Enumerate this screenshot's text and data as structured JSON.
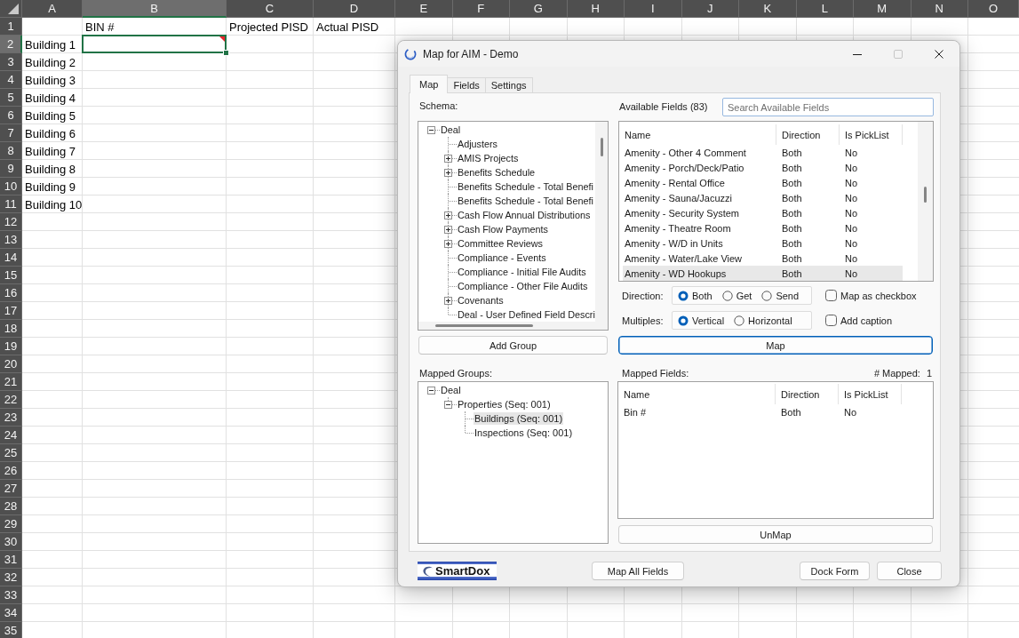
{
  "spreadsheet": {
    "columns": [
      {
        "label": "A",
        "selected": false
      },
      {
        "label": "B",
        "selected": true
      },
      {
        "label": "C",
        "selected": false
      },
      {
        "label": "D",
        "selected": false
      },
      {
        "label": "E",
        "selected": false
      },
      {
        "label": "F",
        "selected": false
      },
      {
        "label": "G",
        "selected": false
      },
      {
        "label": "H",
        "selected": false
      },
      {
        "label": "I",
        "selected": false
      },
      {
        "label": "J",
        "selected": false
      },
      {
        "label": "K",
        "selected": false
      },
      {
        "label": "L",
        "selected": false
      },
      {
        "label": "M",
        "selected": false
      },
      {
        "label": "N",
        "selected": false
      },
      {
        "label": "O",
        "selected": false
      }
    ],
    "rows": [
      {
        "number": "1",
        "selected": false,
        "column_b": "BIN #",
        "column_c": "Projected PISD",
        "column_d": "Actual PISD"
      },
      {
        "number": "2",
        "selected": true,
        "column_a": "Building 1"
      },
      {
        "number": "3",
        "selected": false,
        "column_a": "Building 2"
      },
      {
        "number": "4",
        "selected": false,
        "column_a": "Building 3"
      },
      {
        "number": "5",
        "selected": false,
        "column_a": "Building 4"
      },
      {
        "number": "6",
        "selected": false,
        "column_a": "Building 5"
      },
      {
        "number": "7",
        "selected": false,
        "column_a": "Building 6"
      },
      {
        "number": "8",
        "selected": false,
        "column_a": "Building 7"
      },
      {
        "number": "9",
        "selected": false,
        "column_a": "Building 8"
      },
      {
        "number": "10",
        "selected": false,
        "column_a": "Building 9"
      },
      {
        "number": "11",
        "selected": false,
        "column_a": "Building 10"
      },
      {
        "number": "12",
        "selected": false
      },
      {
        "number": "13",
        "selected": false
      },
      {
        "number": "14",
        "selected": false
      },
      {
        "number": "15",
        "selected": false
      },
      {
        "number": "16",
        "selected": false
      },
      {
        "number": "17",
        "selected": false
      },
      {
        "number": "18",
        "selected": false
      },
      {
        "number": "19",
        "selected": false
      },
      {
        "number": "20",
        "selected": false
      },
      {
        "number": "21",
        "selected": false
      },
      {
        "number": "22",
        "selected": false
      },
      {
        "number": "23",
        "selected": false
      },
      {
        "number": "24",
        "selected": false
      },
      {
        "number": "25",
        "selected": false
      },
      {
        "number": "26",
        "selected": false
      },
      {
        "number": "27",
        "selected": false
      },
      {
        "number": "28",
        "selected": false
      },
      {
        "number": "29",
        "selected": false
      },
      {
        "number": "30",
        "selected": false
      },
      {
        "number": "31",
        "selected": false
      },
      {
        "number": "32",
        "selected": false
      },
      {
        "number": "33",
        "selected": false
      },
      {
        "number": "34",
        "selected": false
      },
      {
        "number": "35",
        "selected": false
      }
    ],
    "note_marker": true
  },
  "dialog": {
    "title": "Map for AIM - Demo",
    "caption_buttons": [
      {
        "kind": "minimize",
        "disabled": false
      },
      {
        "kind": "maximize",
        "disabled": true
      },
      {
        "kind": "close",
        "disabled": false
      }
    ],
    "tabs": [
      {
        "label": "Map",
        "selected": true
      },
      {
        "label": "Fields",
        "selected": false
      },
      {
        "label": "Settings",
        "selected": false
      }
    ],
    "schema": {
      "label": "Schema:",
      "tree": [
        {
          "label": "Deal",
          "kind": "branch",
          "expanded": true,
          "selected": false,
          "children": [
            {
              "label": "Adjusters",
              "kind": "leaf",
              "selected": false
            },
            {
              "label": "AMIS Projects",
              "kind": "branch",
              "expanded": false,
              "selected": false
            },
            {
              "label": "Benefits Schedule",
              "kind": "branch",
              "expanded": false,
              "selected": false
            },
            {
              "label": "Benefits Schedule - Total Benefi",
              "kind": "leaf",
              "selected": false
            },
            {
              "label": "Benefits Schedule - Total Benefi",
              "kind": "leaf",
              "selected": false
            },
            {
              "label": "Cash Flow Annual Distributions",
              "kind": "branch",
              "expanded": false,
              "selected": false
            },
            {
              "label": "Cash Flow Payments",
              "kind": "branch",
              "expanded": false,
              "selected": false
            },
            {
              "label": "Committee Reviews",
              "kind": "branch",
              "expanded": false,
              "selected": false
            },
            {
              "label": "Compliance - Events",
              "kind": "leaf",
              "selected": false
            },
            {
              "label": "Compliance - Initial File Audits",
              "kind": "leaf",
              "selected": false
            },
            {
              "label": "Compliance - Other File Audits",
              "kind": "leaf",
              "selected": false
            },
            {
              "label": "Covenants",
              "kind": "branch",
              "expanded": false,
              "selected": false
            },
            {
              "label": "Deal - User Defined Field Descri",
              "kind": "leaf",
              "selected": false
            }
          ]
        }
      ]
    },
    "available_fields": {
      "label": "Available Fields (83)",
      "search": {
        "placeholder": "Search Available Fields"
      },
      "columns": [
        "Name",
        "Direction",
        "Is PickList"
      ],
      "rows": [
        {
          "name": "Amenity - Other 4 Comment",
          "direction": "Both",
          "is_picklist": "No",
          "selected": false
        },
        {
          "name": "Amenity - Porch/Deck/Patio",
          "direction": "Both",
          "is_picklist": "No",
          "selected": false
        },
        {
          "name": "Amenity - Rental Office",
          "direction": "Both",
          "is_picklist": "No",
          "selected": false
        },
        {
          "name": "Amenity - Sauna/Jacuzzi",
          "direction": "Both",
          "is_picklist": "No",
          "selected": false
        },
        {
          "name": "Amenity - Security System",
          "direction": "Both",
          "is_picklist": "No",
          "selected": false
        },
        {
          "name": "Amenity - Theatre Room",
          "direction": "Both",
          "is_picklist": "No",
          "selected": false
        },
        {
          "name": "Amenity - W/D in Units",
          "direction": "Both",
          "is_picklist": "No",
          "selected": false
        },
        {
          "name": "Amenity - Water/Lake View",
          "direction": "Both",
          "is_picklist": "No",
          "selected": false
        },
        {
          "name": "Amenity - WD Hookups",
          "direction": "Both",
          "is_picklist": "No",
          "selected": true
        }
      ]
    },
    "direction": {
      "label": "Direction:",
      "options": [
        {
          "label": "Both",
          "selected": true
        },
        {
          "label": "Get",
          "selected": false
        },
        {
          "label": "Send",
          "selected": false
        }
      ]
    },
    "multiples": {
      "label": "Multiples:",
      "options": [
        {
          "label": "Vertical",
          "selected": true
        },
        {
          "label": "Horizontal",
          "selected": false
        }
      ]
    },
    "options": [
      {
        "label": "Map as checkbox",
        "checked": false
      },
      {
        "label": "Add caption",
        "checked": false
      }
    ],
    "add_group_button": {
      "label": "Add Group",
      "default": false
    },
    "map_button": {
      "label": "Map",
      "default": true
    },
    "mapped_groups": {
      "label": "Mapped Groups:",
      "tree": [
        {
          "label": "Deal",
          "kind": "branch",
          "expanded": true,
          "selected": false,
          "children": [
            {
              "label": "Properties (Seq: 001)",
              "kind": "branch",
              "expanded": true,
              "selected": false,
              "children": [
                {
                  "label": "Buildings (Seq: 001)",
                  "kind": "leaf",
                  "selected": true
                },
                {
                  "label": "Inspections (Seq: 001)",
                  "kind": "leaf",
                  "selected": false
                }
              ]
            }
          ]
        }
      ]
    },
    "mapped_fields": {
      "label": "Mapped Fields:",
      "count_label": "# Mapped:",
      "count": "1",
      "columns": [
        "Name",
        "Direction",
        "Is PickList"
      ],
      "rows": [
        {
          "name": "Bin #",
          "direction": "Both",
          "is_picklist": "No",
          "selected": false
        }
      ]
    },
    "unmap_button": {
      "label": "UnMap",
      "default": false
    },
    "footer": {
      "logo": "SmartDox",
      "buttons": [
        {
          "label": "Map All Fields",
          "default": false
        },
        {
          "label": "Dock Form",
          "default": false
        },
        {
          "label": "Close",
          "default": false
        }
      ]
    }
  }
}
